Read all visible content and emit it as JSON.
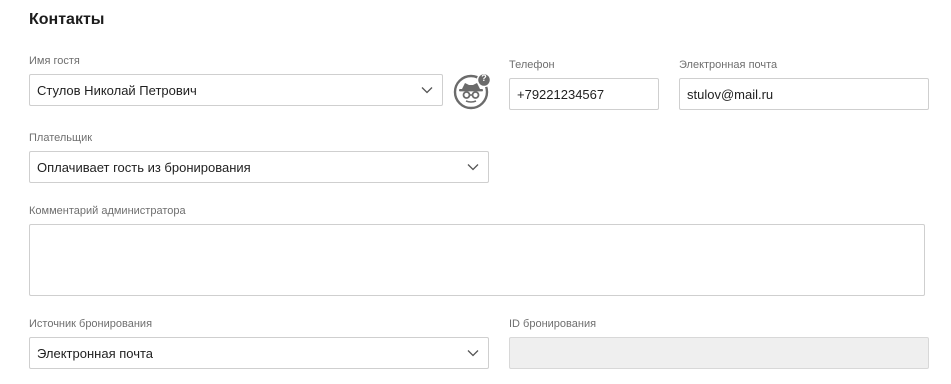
{
  "section": {
    "title": "Контакты"
  },
  "guest": {
    "label": "Имя гостя",
    "value": "Стулов Николай Петрович",
    "profile_badge": "?"
  },
  "phone": {
    "label": "Телефон",
    "value": "+79221234567"
  },
  "email": {
    "label": "Электронная почта",
    "value": "stulov@mail.ru"
  },
  "payer": {
    "label": "Плательщик",
    "value": "Оплачивает гость из бронирования"
  },
  "comment": {
    "label": "Комментарий администратора",
    "value": ""
  },
  "source": {
    "label": "Источник бронирования",
    "value": "Электронная почта"
  },
  "booking_id": {
    "label": "ID бронирования",
    "value": ""
  },
  "colors": {
    "border": "#cfcfcf",
    "label": "#6f6f6f",
    "text": "#1f1f1f",
    "disabled_bg": "#efefef",
    "icon": "#6b6b6b"
  }
}
